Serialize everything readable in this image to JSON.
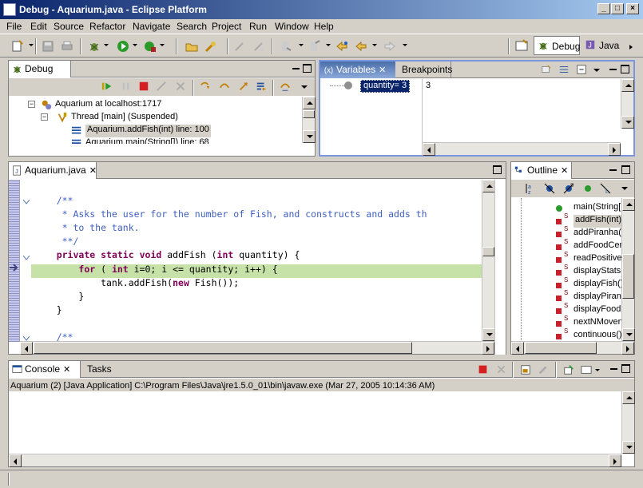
{
  "window": {
    "title": "Debug - Aquarium.java - Eclipse Platform"
  },
  "menubar": {
    "items": [
      "File",
      "Edit",
      "Source",
      "Refactor",
      "Navigate",
      "Search",
      "Project",
      "Run",
      "Window",
      "Help"
    ]
  },
  "perspectives": {
    "debug": "Debug",
    "java": "Java"
  },
  "debug_view": {
    "tab": "Debug",
    "tree": [
      "Aquarium at localhost:1717",
      "Thread [main] (Suspended)",
      "Aquarium.addFish(int) line: 100",
      "Aquarium.main(String[]) line: 68"
    ]
  },
  "variables_view": {
    "tabs": [
      "Variables",
      "Breakpoints"
    ],
    "variable": "quantity= 3",
    "detail": "3"
  },
  "editor": {
    "tab": "Aquarium.java",
    "lines": [
      "    /**",
      "     * Asks the user for the number of Fish, and constructs and adds th",
      "     * to the tank.",
      "     **/",
      "    private static void addFish (int quantity) {",
      "        for ( int i=0; i <= quantity; i++) {",
      "            tank.addFish(new Fish());",
      "        }",
      "    }",
      "",
      "    /**"
    ]
  },
  "outline_view": {
    "tab": "Outline",
    "items": [
      "main(String[",
      "addFish(int)",
      "addPiranha(i",
      "addFoodCen",
      "readPositive",
      "displayStats",
      "displayFish()",
      "displayPiranh",
      "displayFood(",
      "nextNMoven",
      "continuous()"
    ]
  },
  "console_view": {
    "tabs": [
      "Console",
      "Tasks"
    ],
    "process": "Aquarium (2) [Java Application] C:\\Program Files\\Java\\jre1.5.0_01\\bin\\javaw.exe (Mar 27, 2005 10:14:36 AM)"
  },
  "colors": {
    "title_start": "#0a246a",
    "title_end": "#a6caf0",
    "current_line": "#c6e2a8",
    "selection": "#0a246a"
  }
}
